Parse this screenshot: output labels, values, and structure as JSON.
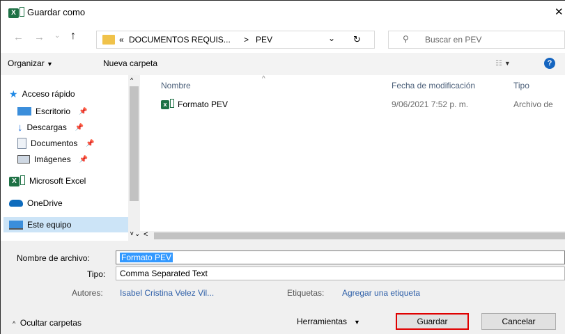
{
  "window": {
    "title": "Guardar como",
    "app_icon": "excel-icon",
    "close_glyph": "✕"
  },
  "address": {
    "path_prefix": "«",
    "path_segment1": "DOCUMENTOS REQUIS...",
    "path_sep": ">",
    "path_segment2": "PEV",
    "search_placeholder": "Buscar en PEV"
  },
  "toolbar": {
    "organize_label": "Organizar",
    "new_folder_label": "Nueva carpeta"
  },
  "sidebar": {
    "items": [
      {
        "label": "Acceso rápido",
        "icon": "star-icon"
      },
      {
        "label": "Escritorio",
        "icon": "desktop-icon"
      },
      {
        "label": "Descargas",
        "icon": "download-icon"
      },
      {
        "label": "Documentos",
        "icon": "documents-icon"
      },
      {
        "label": "Imágenes",
        "icon": "pictures-icon"
      },
      {
        "label": "Microsoft Excel",
        "icon": "excel-icon"
      },
      {
        "label": "OneDrive",
        "icon": "cloud-icon"
      },
      {
        "label": "Este equipo",
        "icon": "computer-icon"
      }
    ]
  },
  "files": {
    "columns": [
      "Nombre",
      "Fecha de modificación",
      "Tipo"
    ],
    "rows": [
      {
        "name": "Formato PEV",
        "date": "9/06/2021 7:52 p. m.",
        "type": "Archivo de"
      }
    ]
  },
  "form": {
    "filename_label": "Nombre de archivo:",
    "filename_value": "Formato PEV",
    "type_label": "Tipo:",
    "type_value": "Comma Separated Text",
    "authors_label": "Autores:",
    "authors_value": "Isabel Cristina Velez Vil...",
    "tags_label": "Etiquetas:",
    "tags_value": "Agregar una etiqueta"
  },
  "footer": {
    "hide_folders_label": "Ocultar carpetas",
    "tools_label": "Herramientas",
    "save_label": "Guardar",
    "cancel_label": "Cancelar"
  },
  "colors": {
    "excel_green": "#1e7145",
    "selection_blue": "#3399ff",
    "save_border": "#e00000"
  }
}
